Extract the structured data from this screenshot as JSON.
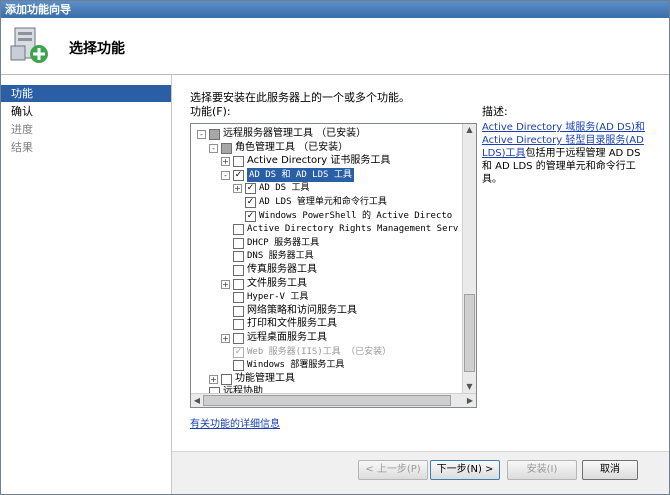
{
  "window": {
    "title": "添加功能向导"
  },
  "header": {
    "title": "选择功能"
  },
  "steps": [
    {
      "label": "功能"
    },
    {
      "label": "确认"
    },
    {
      "label": "进度"
    },
    {
      "label": "结果"
    }
  ],
  "main": {
    "instruction": "选择要安装在此服务器上的一个或多个功能。",
    "features_label": "功能(F):",
    "description_label": "描述:",
    "description_link": "Active Directory 域服务(AD DS)和 Active Directory 轻型目录服务(AD LDS)工具",
    "description_text": "包括用于远程管理 AD DS 和 AD LDS 的管理单元和命令行工具。",
    "more_info_link": "有关功能的详细信息"
  },
  "tree": [
    {
      "label": "远程服务器管理工具  （已安装）",
      "expander": "-",
      "check": "partial"
    },
    {
      "label": "角色管理工具  （已安装）",
      "expander": "-",
      "check": "partial"
    },
    {
      "label": "Active Directory 证书服务工具",
      "expander": "+",
      "check": "none"
    },
    {
      "label": "AD DS 和 AD LDS 工具",
      "expander": "-",
      "check": "checked"
    },
    {
      "label": "AD DS 工具",
      "expander": "+",
      "check": "checked"
    },
    {
      "label": "AD LDS 管理单元和命令行工具",
      "expander": "",
      "check": "checked"
    },
    {
      "label": "Windows PowerShell 的 Active Directo",
      "expander": "",
      "check": "checked"
    },
    {
      "label": "Active Directory Rights Management Serv",
      "expander": "",
      "check": "none"
    },
    {
      "label": "DHCP 服务器工具",
      "expander": "",
      "check": "none"
    },
    {
      "label": "DNS 服务器工具",
      "expander": "",
      "check": "none"
    },
    {
      "label": "传真服务器工具",
      "expander": "",
      "check": "none"
    },
    {
      "label": "文件服务工具",
      "expander": "+",
      "check": "none"
    },
    {
      "label": "Hyper-V 工具",
      "expander": "",
      "check": "none"
    },
    {
      "label": "网络策略和访问服务工具",
      "expander": "",
      "check": "none"
    },
    {
      "label": "打印和文件服务工具",
      "expander": "",
      "check": "none"
    },
    {
      "label": "远程桌面服务工具",
      "expander": "+",
      "check": "none"
    },
    {
      "label": "Web 服务器(IIS)工具    （已安装）",
      "expander": "",
      "check": "disabled"
    },
    {
      "label": "Windows 部署服务工具",
      "expander": "",
      "check": "none"
    },
    {
      "label": "功能管理工具",
      "expander": "+",
      "check": "none"
    },
    {
      "label": "远程协助",
      "expander": "",
      "check": "none"
    }
  ],
  "buttons": {
    "prev": "< 上一步(P)",
    "next": "下一步(N) >",
    "install": "安装(I)",
    "cancel": "取消"
  },
  "colors": {
    "selection": "#2a5fa6",
    "link": "#1a3fb0"
  }
}
